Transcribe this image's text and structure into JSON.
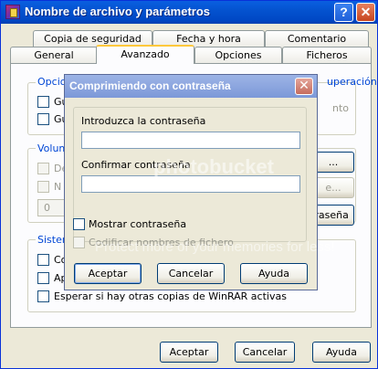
{
  "window": {
    "title": "Nombre de archivo y parámetros",
    "help_glyph": "?",
    "close_glyph": "✕"
  },
  "tabs_top": [
    "Copia de seguridad",
    "Fecha y hora",
    "Comentario"
  ],
  "tabs_bottom": [
    "General",
    "Avanzado",
    "Opciones",
    "Ficheros"
  ],
  "panel": {
    "group1_label": "Opcio",
    "group1_right_label": "uperación",
    "item1": "Gu",
    "item2": "Gu",
    "item2_right": "nto",
    "group2_label": "Volum",
    "item3": "De",
    "item4": "N",
    "combo_value": "0",
    "right_btn1": "...",
    "right_btn2": "e...",
    "password_btn": "traseña",
    "group3_label": "Sistem",
    "item5": "Co",
    "item6": "Ap",
    "item7": "Esperar si hay otras copias de WinRAR activas"
  },
  "dialog": {
    "title": "Comprimiendo con contraseña",
    "close_glyph": "✕",
    "enter_label": "Introduzca la contraseña",
    "enter_value": "",
    "confirm_label": "Confirmar contraseña",
    "confirm_value": "",
    "show_password": "Mostrar contraseña",
    "encrypt_names": "Codificar nombres de fichero",
    "ok": "Aceptar",
    "cancel": "Cancelar",
    "help": "Ayuda"
  },
  "bottom_buttons": {
    "ok": "Aceptar",
    "cancel": "Cancelar",
    "help": "Ayuda"
  },
  "watermarks": [
    "photobucket",
    "Protect more of your memories for less!"
  ]
}
